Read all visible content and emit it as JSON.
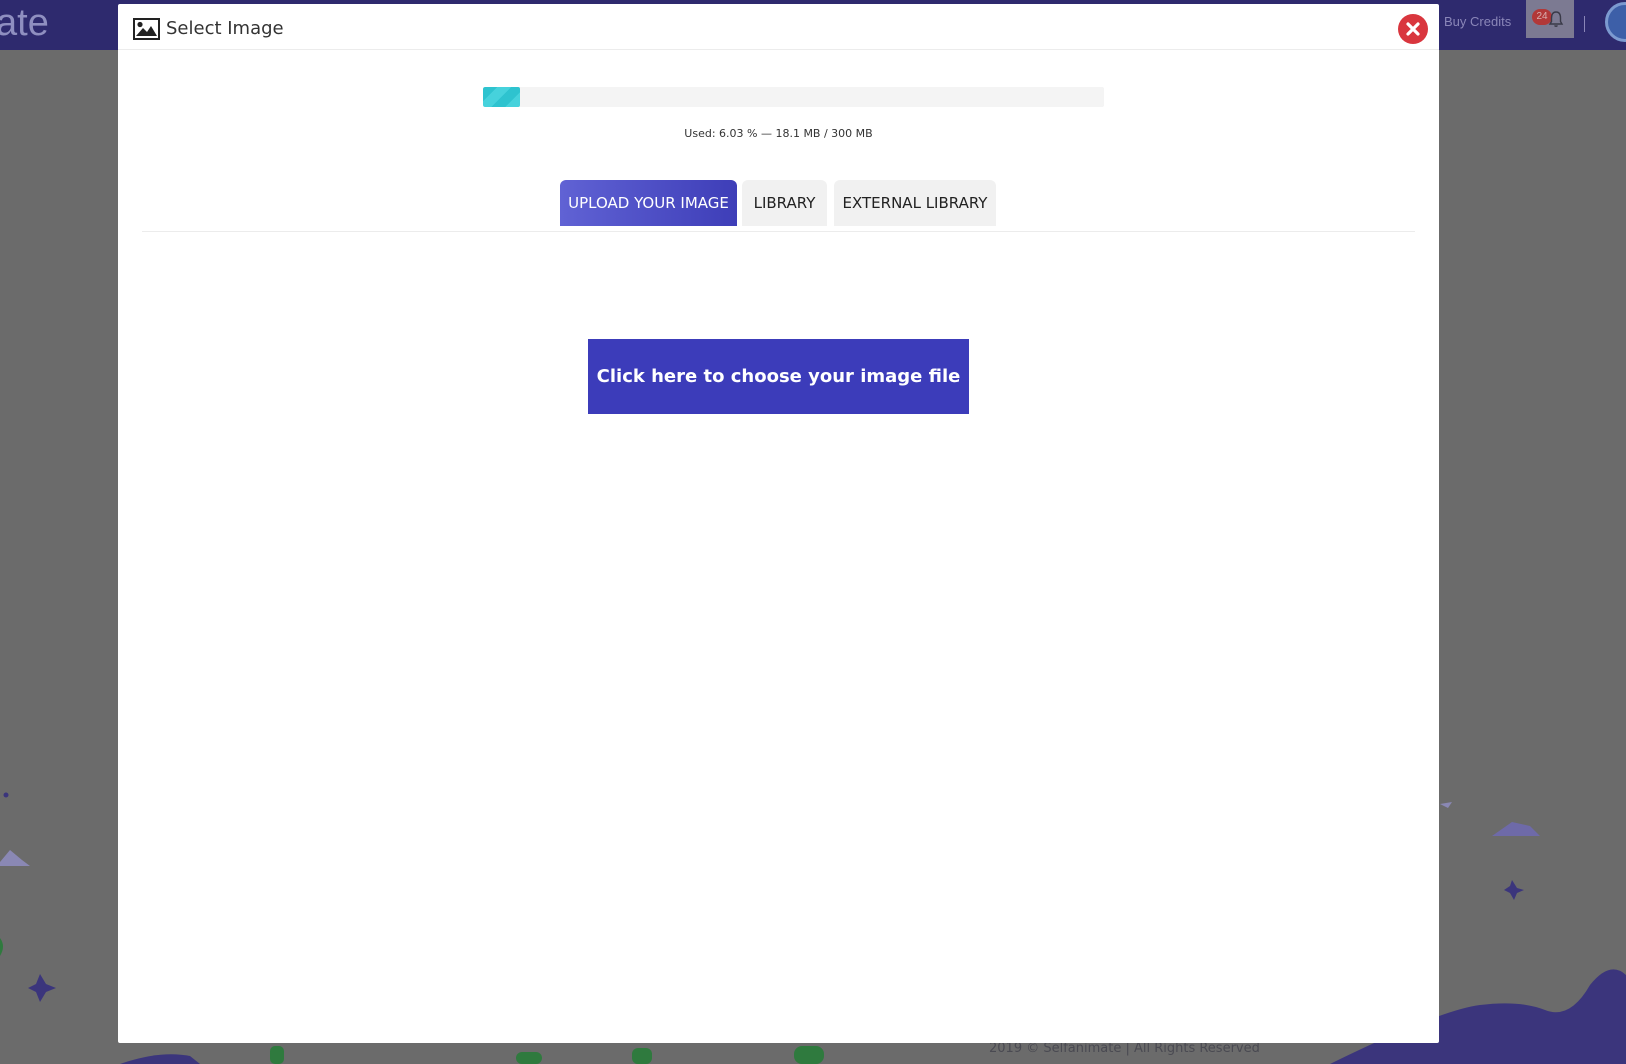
{
  "app": {
    "brand_fragment": "ate",
    "buy_credits": "Buy Credits",
    "notification_count": "24",
    "footer": "2019 © Selfanimate | All Rights Reserved"
  },
  "modal": {
    "title": "Select Image",
    "close_icon": "close-x-icon",
    "usage": {
      "percent": 6.03,
      "text": "Used: 6.03 % — 18.1 MB / 300 MB"
    },
    "tabs": [
      {
        "label": "UPLOAD YOUR IMAGE",
        "active": true
      },
      {
        "label": "LIBRARY",
        "active": false
      },
      {
        "label": "EXTERNAL LIBRARY",
        "active": false
      }
    ],
    "choose_button": "Click here to choose your image file"
  },
  "colors": {
    "accent": "#3c3cba",
    "progress": "#2ec3cf",
    "close": "#d9363e",
    "header_bg": "#2e2a6e"
  }
}
